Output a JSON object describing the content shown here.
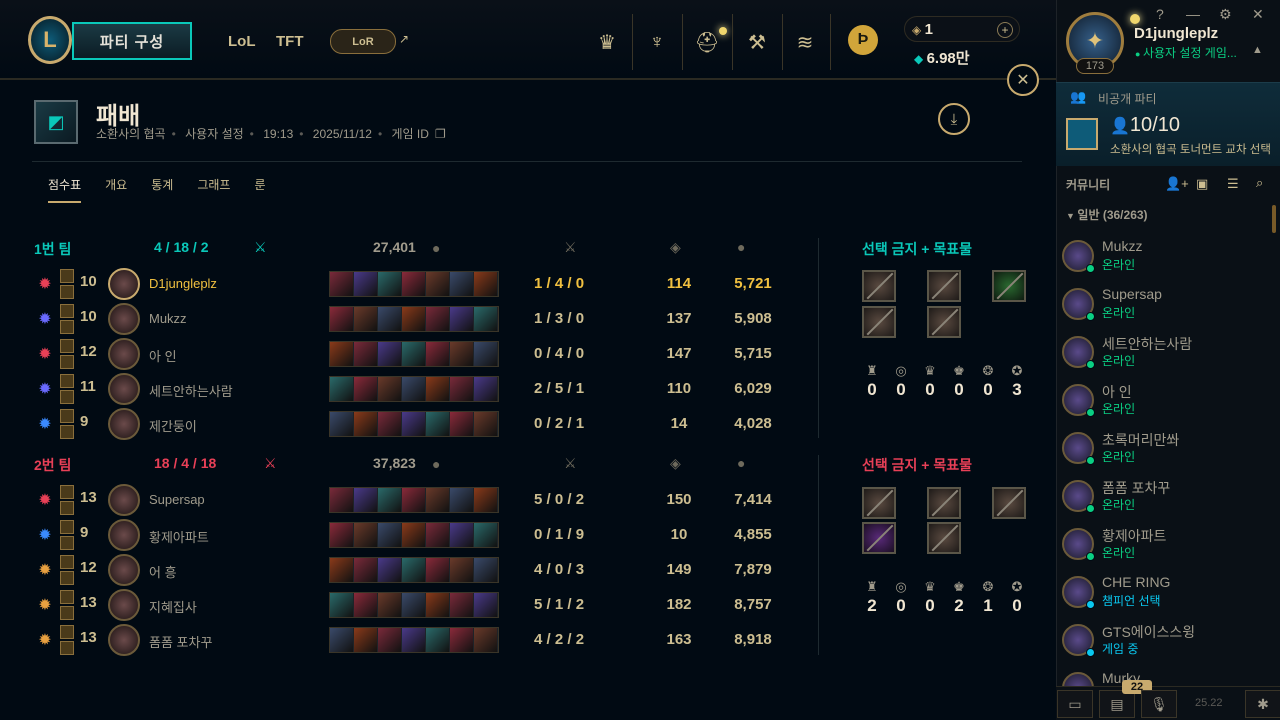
{
  "topbar": {
    "party_button": "파티 구성",
    "modes": [
      "LoL",
      "TFT"
    ],
    "lor_label": "LoR",
    "rp": "1",
    "be": "6.98만"
  },
  "profile": {
    "name": "D1jungleplz",
    "status": "사용자 설정 게임...",
    "level": "173"
  },
  "party_card": {
    "title": "비공개 파티",
    "count": "10/10",
    "subtitle": "소환사의 협곡 토너먼트 교차 선택"
  },
  "social": {
    "community_label": "커뮤니티",
    "group_label": "일반 (36/263)",
    "friends": [
      {
        "name": "Mukzz",
        "status": "온라인",
        "color": "#0acf83"
      },
      {
        "name": "Supersap",
        "status": "온라인",
        "color": "#0acf83"
      },
      {
        "name": "세트안하는사람",
        "status": "온라인",
        "color": "#0acf83"
      },
      {
        "name": "아 인",
        "status": "온라인",
        "color": "#0acf83"
      },
      {
        "name": "초록머리만쏴",
        "status": "온라인",
        "color": "#0acf83"
      },
      {
        "name": "폼폼 포차꾸",
        "status": "온라인",
        "color": "#0acf83"
      },
      {
        "name": "황제아파트",
        "status": "온라인",
        "color": "#0acf83"
      },
      {
        "name": "CHE RING",
        "status": "챔피언 선택",
        "color": "#0ac8f0"
      },
      {
        "name": "GTS에이스스윙",
        "status": "게임 중",
        "color": "#0ac8f0"
      },
      {
        "name": "Murky",
        "status": "",
        "color": "#0acf83"
      }
    ],
    "chat_badge": "22",
    "version": "25.22"
  },
  "match": {
    "result": "패배",
    "meta": [
      "소환사의 협곡",
      "사용자 설정",
      "19:13",
      "2025/11/12",
      "게임 ID"
    ],
    "tabs": [
      "점수표",
      "개요",
      "통계",
      "그래프",
      "룬"
    ]
  },
  "team1": {
    "label": "1번 팀",
    "kda": "4 / 18 / 2",
    "gold": "27,401",
    "bans_label": "선택 금지 + 목표물",
    "objectives": [
      "0",
      "0",
      "0",
      "0",
      "0",
      "3"
    ],
    "players": [
      {
        "level": "10",
        "name": "D1jungleplz",
        "kda": "1 / 4 / 0",
        "cs": "114",
        "gold": "5,721",
        "me": true
      },
      {
        "level": "10",
        "name": "Mukzz",
        "kda": "1 / 3 / 0",
        "cs": "137",
        "gold": "5,908"
      },
      {
        "level": "12",
        "name": "아 인",
        "kda": "0 / 4 / 0",
        "cs": "147",
        "gold": "5,715"
      },
      {
        "level": "11",
        "name": "세트안하는사람",
        "kda": "2 / 5 / 1",
        "cs": "110",
        "gold": "6,029"
      },
      {
        "level": "9",
        "name": "제간둥이",
        "kda": "0 / 2 / 1",
        "cs": "14",
        "gold": "4,028"
      }
    ]
  },
  "team2": {
    "label": "2번 팀",
    "kda": "18 / 4 / 18",
    "gold": "37,823",
    "bans_label": "선택 금지 + 목표물",
    "objectives": [
      "2",
      "0",
      "0",
      "2",
      "1",
      "0"
    ],
    "players": [
      {
        "level": "13",
        "name": "Supersap",
        "kda": "5 / 0 / 2",
        "cs": "150",
        "gold": "7,414"
      },
      {
        "level": "9",
        "name": "황제아파트",
        "kda": "0 / 1 / 9",
        "cs": "10",
        "gold": "4,855"
      },
      {
        "level": "12",
        "name": "어 흥",
        "kda": "4 / 0 / 3",
        "cs": "149",
        "gold": "7,879"
      },
      {
        "level": "13",
        "name": "지혜집사",
        "kda": "5 / 1 / 2",
        "cs": "182",
        "gold": "8,757"
      },
      {
        "level": "13",
        "name": "폼폼 포차꾸",
        "kda": "4 / 2 / 2",
        "cs": "163",
        "gold": "8,918"
      }
    ]
  }
}
